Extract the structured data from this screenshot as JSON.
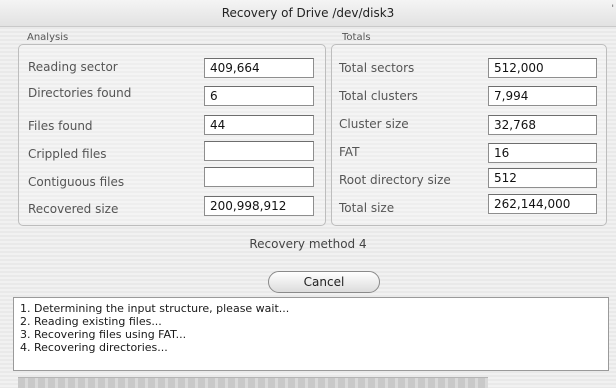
{
  "window": {
    "title": "Recovery of Drive /dev/disk3",
    "corner_mark": "'"
  },
  "analysis": {
    "label": "Analysis",
    "rows": [
      {
        "label": "Reading sector",
        "value": "409,664"
      },
      {
        "label": "Directories found",
        "value": "6"
      },
      {
        "label": "Files found",
        "value": "44"
      },
      {
        "label": "Crippled files",
        "value": ""
      },
      {
        "label": "Contiguous files",
        "value": ""
      },
      {
        "label": "Recovered size",
        "value": "200,998,912"
      }
    ]
  },
  "totals": {
    "label": "Totals",
    "rows": [
      {
        "label": "Total sectors",
        "value": "512,000"
      },
      {
        "label": "Total clusters",
        "value": "7,994"
      },
      {
        "label": "Cluster size",
        "value": "32,768"
      },
      {
        "label": "FAT",
        "value": "16"
      },
      {
        "label": "Root directory size",
        "value": "512"
      },
      {
        "label": "Total size",
        "value": "262,144,000"
      }
    ]
  },
  "method_text": "Recovery method 4",
  "cancel_label": "Cancel",
  "log": [
    "1. Determining the input structure, please wait...",
    "2. Reading existing files...",
    "3. Recovering files using FAT...",
    "4. Recovering directories..."
  ]
}
